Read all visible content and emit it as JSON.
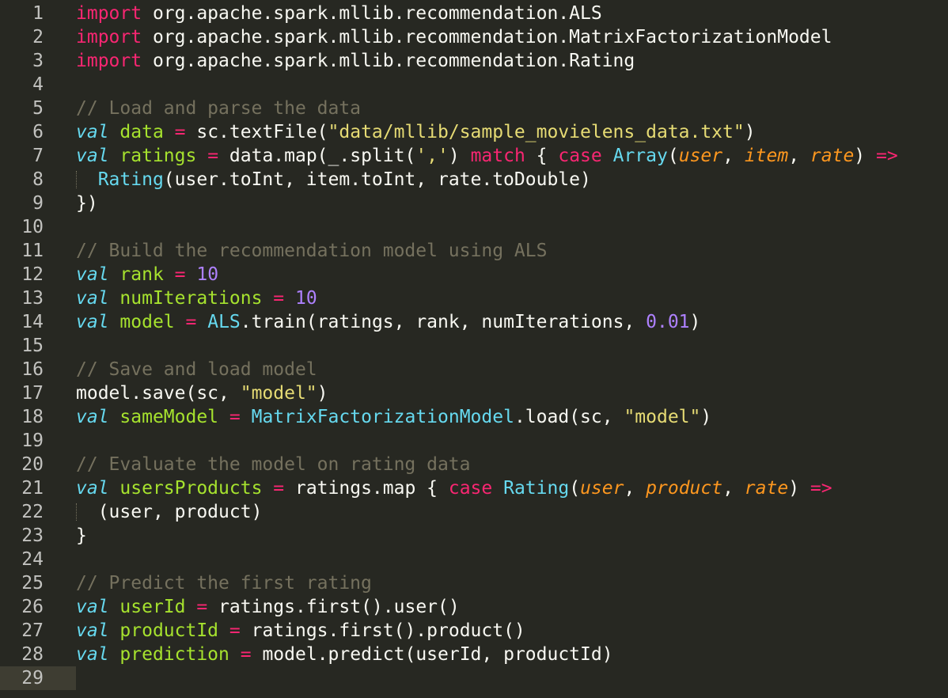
{
  "editor": {
    "colors": {
      "background": "#272822",
      "current_line": "#3E3D32",
      "keyword": "#F92672",
      "storage": "#66D9EF",
      "name": "#A6E22E",
      "string": "#E6DB74",
      "number": "#AE81FF",
      "comment": "#75715E",
      "parameter": "#FD971F",
      "text": "#F8F8F2",
      "gutter_text": "#C2C2BF"
    },
    "current_line_number": 29,
    "lines": [
      {
        "n": "1",
        "tokens": [
          {
            "t": "import",
            "c": "kw"
          },
          {
            "t": " org.apache.spark.mllib.recommendation.ALS",
            "c": ""
          }
        ]
      },
      {
        "n": "2",
        "tokens": [
          {
            "t": "import",
            "c": "kw"
          },
          {
            "t": " org.apache.spark.mllib.recommendation.MatrixFactorizationModel",
            "c": ""
          }
        ]
      },
      {
        "n": "3",
        "tokens": [
          {
            "t": "import",
            "c": "kw"
          },
          {
            "t": " org.apache.spark.mllib.recommendation.Rating",
            "c": ""
          }
        ]
      },
      {
        "n": "4",
        "tokens": []
      },
      {
        "n": "5",
        "tokens": [
          {
            "t": "// Load and parse the data",
            "c": "cm"
          }
        ]
      },
      {
        "n": "6",
        "tokens": [
          {
            "t": "val",
            "c": "st"
          },
          {
            "t": " ",
            "c": ""
          },
          {
            "t": "data",
            "c": "nm"
          },
          {
            "t": " ",
            "c": ""
          },
          {
            "t": "=",
            "c": "op"
          },
          {
            "t": " sc.textFile(",
            "c": ""
          },
          {
            "t": "\"data/mllib/sample_movielens_data.txt\"",
            "c": "str"
          },
          {
            "t": ")",
            "c": ""
          }
        ]
      },
      {
        "n": "7",
        "tokens": [
          {
            "t": "val",
            "c": "st"
          },
          {
            "t": " ",
            "c": ""
          },
          {
            "t": "ratings",
            "c": "nm"
          },
          {
            "t": " ",
            "c": ""
          },
          {
            "t": "=",
            "c": "op"
          },
          {
            "t": " data.map(_.split(",
            "c": ""
          },
          {
            "t": "','",
            "c": "str"
          },
          {
            "t": ") ",
            "c": ""
          },
          {
            "t": "match",
            "c": "kw"
          },
          {
            "t": " { ",
            "c": ""
          },
          {
            "t": "case",
            "c": "kw"
          },
          {
            "t": " ",
            "c": ""
          },
          {
            "t": "Array",
            "c": "ty"
          },
          {
            "t": "(",
            "c": ""
          },
          {
            "t": "user",
            "c": "pa"
          },
          {
            "t": ", ",
            "c": ""
          },
          {
            "t": "item",
            "c": "pa"
          },
          {
            "t": ", ",
            "c": ""
          },
          {
            "t": "rate",
            "c": "pa"
          },
          {
            "t": ") ",
            "c": ""
          },
          {
            "t": "=>",
            "c": "op"
          }
        ]
      },
      {
        "n": "8",
        "indent": "  ",
        "tokens": [
          {
            "t": "Rating",
            "c": "ty"
          },
          {
            "t": "(user.toInt, item.toInt, rate.toDouble)",
            "c": ""
          }
        ]
      },
      {
        "n": "9",
        "tokens": [
          {
            "t": "})",
            "c": ""
          }
        ]
      },
      {
        "n": "10",
        "tokens": []
      },
      {
        "n": "11",
        "tokens": [
          {
            "t": "// Build the recommendation model using ALS",
            "c": "cm"
          }
        ]
      },
      {
        "n": "12",
        "tokens": [
          {
            "t": "val",
            "c": "st"
          },
          {
            "t": " ",
            "c": ""
          },
          {
            "t": "rank",
            "c": "nm"
          },
          {
            "t": " ",
            "c": ""
          },
          {
            "t": "=",
            "c": "op"
          },
          {
            "t": " ",
            "c": ""
          },
          {
            "t": "10",
            "c": "num"
          }
        ]
      },
      {
        "n": "13",
        "tokens": [
          {
            "t": "val",
            "c": "st"
          },
          {
            "t": " ",
            "c": ""
          },
          {
            "t": "numIterations",
            "c": "nm"
          },
          {
            "t": " ",
            "c": ""
          },
          {
            "t": "=",
            "c": "op"
          },
          {
            "t": " ",
            "c": ""
          },
          {
            "t": "10",
            "c": "num"
          }
        ]
      },
      {
        "n": "14",
        "tokens": [
          {
            "t": "val",
            "c": "st"
          },
          {
            "t": " ",
            "c": ""
          },
          {
            "t": "model",
            "c": "nm"
          },
          {
            "t": " ",
            "c": ""
          },
          {
            "t": "=",
            "c": "op"
          },
          {
            "t": " ",
            "c": ""
          },
          {
            "t": "ALS",
            "c": "ty"
          },
          {
            "t": ".train(ratings, rank, numIterations, ",
            "c": ""
          },
          {
            "t": "0.01",
            "c": "num"
          },
          {
            "t": ")",
            "c": ""
          }
        ]
      },
      {
        "n": "15",
        "tokens": []
      },
      {
        "n": "16",
        "tokens": [
          {
            "t": "// Save and load model",
            "c": "cm"
          }
        ]
      },
      {
        "n": "17",
        "tokens": [
          {
            "t": "model.save(sc, ",
            "c": ""
          },
          {
            "t": "\"model\"",
            "c": "str"
          },
          {
            "t": ")",
            "c": ""
          }
        ]
      },
      {
        "n": "18",
        "tokens": [
          {
            "t": "val",
            "c": "st"
          },
          {
            "t": " ",
            "c": ""
          },
          {
            "t": "sameModel",
            "c": "nm"
          },
          {
            "t": " ",
            "c": ""
          },
          {
            "t": "=",
            "c": "op"
          },
          {
            "t": " ",
            "c": ""
          },
          {
            "t": "MatrixFactorizationModel",
            "c": "ty"
          },
          {
            "t": ".load(sc, ",
            "c": ""
          },
          {
            "t": "\"model\"",
            "c": "str"
          },
          {
            "t": ")",
            "c": ""
          }
        ]
      },
      {
        "n": "19",
        "tokens": []
      },
      {
        "n": "20",
        "tokens": [
          {
            "t": "// Evaluate the model on rating data",
            "c": "cm"
          }
        ]
      },
      {
        "n": "21",
        "tokens": [
          {
            "t": "val",
            "c": "st"
          },
          {
            "t": " ",
            "c": ""
          },
          {
            "t": "usersProducts",
            "c": "nm"
          },
          {
            "t": " ",
            "c": ""
          },
          {
            "t": "=",
            "c": "op"
          },
          {
            "t": " ratings.map { ",
            "c": ""
          },
          {
            "t": "case",
            "c": "kw"
          },
          {
            "t": " ",
            "c": ""
          },
          {
            "t": "Rating",
            "c": "ty"
          },
          {
            "t": "(",
            "c": ""
          },
          {
            "t": "user",
            "c": "pa"
          },
          {
            "t": ", ",
            "c": ""
          },
          {
            "t": "product",
            "c": "pa"
          },
          {
            "t": ", ",
            "c": ""
          },
          {
            "t": "rate",
            "c": "pa"
          },
          {
            "t": ") ",
            "c": ""
          },
          {
            "t": "=>",
            "c": "op"
          }
        ]
      },
      {
        "n": "22",
        "indent": "  ",
        "tokens": [
          {
            "t": "(user, product)",
            "c": ""
          }
        ]
      },
      {
        "n": "23",
        "tokens": [
          {
            "t": "}",
            "c": ""
          }
        ]
      },
      {
        "n": "24",
        "tokens": []
      },
      {
        "n": "25",
        "tokens": [
          {
            "t": "// Predict the first rating",
            "c": "cm"
          }
        ]
      },
      {
        "n": "26",
        "tokens": [
          {
            "t": "val",
            "c": "st"
          },
          {
            "t": " ",
            "c": ""
          },
          {
            "t": "userId",
            "c": "nm"
          },
          {
            "t": " ",
            "c": ""
          },
          {
            "t": "=",
            "c": "op"
          },
          {
            "t": " ratings.first().user()",
            "c": ""
          }
        ]
      },
      {
        "n": "27",
        "tokens": [
          {
            "t": "val",
            "c": "st"
          },
          {
            "t": " ",
            "c": ""
          },
          {
            "t": "productId",
            "c": "nm"
          },
          {
            "t": " ",
            "c": ""
          },
          {
            "t": "=",
            "c": "op"
          },
          {
            "t": " ratings.first().product()",
            "c": ""
          }
        ]
      },
      {
        "n": "28",
        "tokens": [
          {
            "t": "val",
            "c": "st"
          },
          {
            "t": " ",
            "c": ""
          },
          {
            "t": "prediction",
            "c": "nm"
          },
          {
            "t": " ",
            "c": ""
          },
          {
            "t": "=",
            "c": "op"
          },
          {
            "t": " model.predict(userId, productId)",
            "c": ""
          }
        ]
      },
      {
        "n": "29",
        "tokens": []
      }
    ]
  }
}
